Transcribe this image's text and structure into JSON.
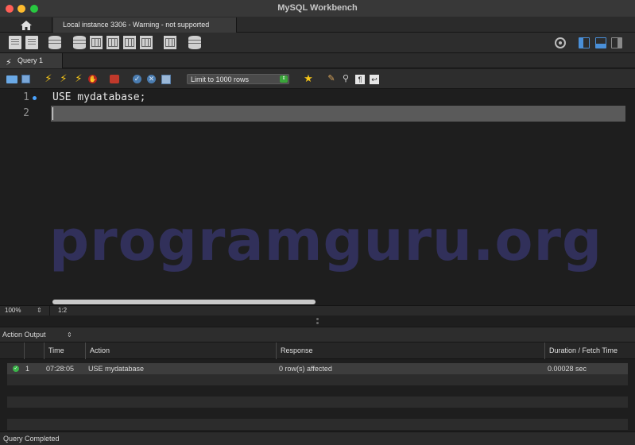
{
  "window": {
    "title": "MySQL Workbench"
  },
  "connection_tabs": {
    "active_label": "Local instance 3306 - Warning - not supported"
  },
  "query_tabs": {
    "active_label": "Query 1"
  },
  "editor_toolbar": {
    "limit_select": {
      "value": "Limit to 1000 rows"
    }
  },
  "editor": {
    "lines": [
      {
        "number": "1",
        "text": "USE mydatabase;"
      },
      {
        "number": "2",
        "text": ""
      }
    ],
    "watermark": "programguru.org"
  },
  "editor_status": {
    "zoom": "100%",
    "cursor_position": "1:2"
  },
  "output": {
    "panel_select": "Action Output",
    "columns": [
      "",
      "Time",
      "Action",
      "Response",
      "Duration / Fetch Time"
    ],
    "rows": [
      {
        "status": "ok",
        "index": "1",
        "time": "07:28:05",
        "action": "USE mydatabase",
        "response": "0 row(s) affected",
        "duration": "0.00028 sec"
      }
    ]
  },
  "status_bar": {
    "text": "Query Completed"
  },
  "colors": {
    "accent": "#4a90d9",
    "success": "#3bb54a",
    "watermark": "#31305a",
    "editor_bg": "#1e1e1e"
  },
  "icons": {
    "toolbar": [
      "new-sql-tab-icon",
      "open-sql-script-icon",
      "open-inspector-icon",
      "create-schema-icon",
      "create-table-icon",
      "create-view-icon",
      "create-procedure-icon",
      "create-function-icon",
      "search-table-data-icon",
      "reconnect-icon"
    ],
    "editor_toolbar": [
      "open-file-icon",
      "save-file-icon",
      "execute-icon",
      "execute-current-icon",
      "explain-icon",
      "stop-icon",
      "toggle-continue-on-error-icon",
      "commit-icon",
      "rollback-icon",
      "autocommit-icon",
      "beautify-icon",
      "clear-icon",
      "find-icon",
      "invisible-chars-icon",
      "word-wrap-icon"
    ]
  }
}
